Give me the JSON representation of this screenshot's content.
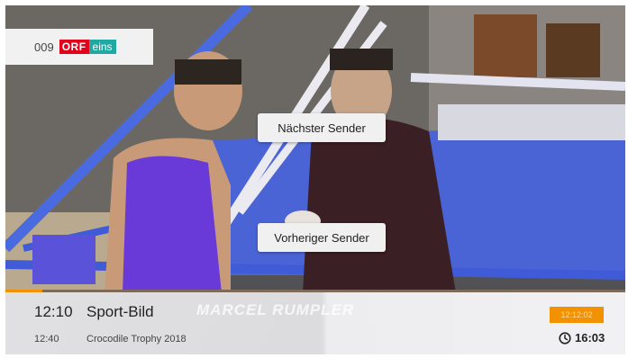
{
  "channel": {
    "number": "009",
    "logo_orf": "ORF",
    "logo_eins": "eins",
    "logo_colors": {
      "orf_red": "#e3001b",
      "eins_teal": "#20a9a3"
    }
  },
  "controls": {
    "next_channel_label": "Nächster Sender",
    "previous_channel_label": "Vorheriger Sender"
  },
  "video": {
    "overlay_caption": "MARCEL RUMPLER"
  },
  "epg": {
    "progress_percent": 6,
    "current": {
      "time": "12:10",
      "title": "Sport-Bild"
    },
    "next": {
      "time": "12:40",
      "title": "Crocodile Trophy 2018"
    },
    "badge_time": "12:12:02",
    "clock_icon": "clock-icon",
    "clock_time": "16:03",
    "accent_color": "#f39200"
  }
}
